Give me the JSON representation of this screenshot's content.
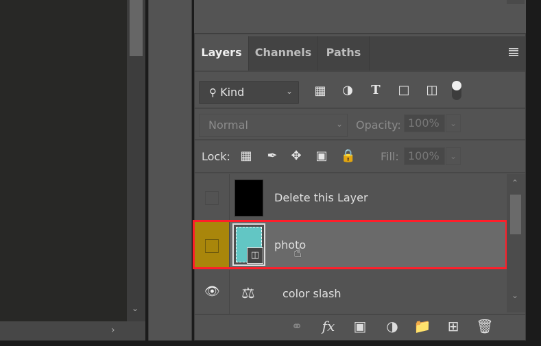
{
  "tabs": [
    "Layers",
    "Channels",
    "Paths"
  ],
  "filter": {
    "label": "Kind",
    "icons": [
      "image-filter-icon",
      "adjustment-filter-icon",
      "type-filter-icon",
      "shape-filter-icon",
      "smart-object-filter-icon",
      "filter-toggle"
    ]
  },
  "blend_mode": "Normal",
  "opacity_label": "Opacity:",
  "opacity_value": "100%",
  "lock_label": "Lock:",
  "fill_label": "Fill:",
  "fill_value": "100%",
  "layers": [
    {
      "name": "Delete this Layer",
      "visible": false,
      "selected": false
    },
    {
      "name": "photo",
      "visible": false,
      "selected": true
    },
    {
      "name": "color slash",
      "visible": true,
      "selected": false
    }
  ],
  "colors": {
    "highlight": "#ff1e2a",
    "visibility_selected": "#a9860b",
    "thumb_teal": "#62c6c4"
  }
}
